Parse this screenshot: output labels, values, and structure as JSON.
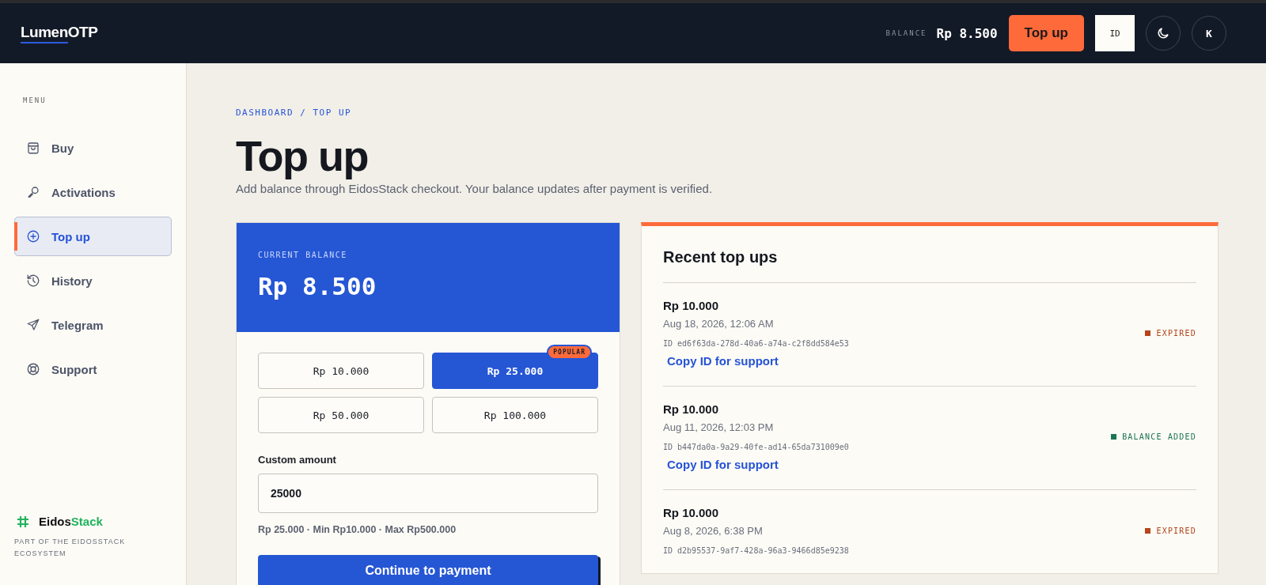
{
  "header": {
    "logo_left": "Lumen",
    "logo_right": "OTP",
    "balance_label": "BALANCE",
    "balance_value": "Rp 8.500",
    "topup_button": "Top up",
    "language_button": "ID",
    "avatar_initial": "K"
  },
  "sidebar": {
    "heading": "MENU",
    "items": [
      {
        "label": "Buy",
        "selected": false
      },
      {
        "label": "Activations",
        "selected": false
      },
      {
        "label": "Top up",
        "selected": true
      },
      {
        "label": "History",
        "selected": false
      },
      {
        "label": "Telegram",
        "selected": false
      },
      {
        "label": "Support",
        "selected": false
      }
    ],
    "footer": {
      "brand_left": "Eidos",
      "brand_right": "Stack",
      "caption": "PART OF THE EIDOSSTACK ECOSYSTEM"
    }
  },
  "breadcrumb": "DASHBOARD / TOP UP",
  "title": "Top up",
  "subtitle": "Add balance through EidosStack checkout. Your balance updates after payment is verified.",
  "balance_card": {
    "label": "CURRENT BALANCE",
    "value": "Rp 8.500"
  },
  "presets": [
    {
      "label": "Rp 10.000",
      "selected": false,
      "kind": "plain"
    },
    {
      "label": "Rp 25.000",
      "selected": true,
      "kind": "popular"
    },
    {
      "label": "Rp 50.000",
      "selected": false,
      "kind": "plain"
    },
    {
      "label": "Rp 100.000",
      "selected": false,
      "kind": "plain"
    }
  ],
  "popular_badge": "POPULAR",
  "custom_amount": {
    "label": "Custom amount",
    "value": "25000",
    "hint": "Rp 25.000 · Min Rp10.000 · Max Rp500.000"
  },
  "continue_button": "Continue to payment",
  "recent": {
    "title": "Recent top ups",
    "items": [
      {
        "amount": "Rp 10.000",
        "date": "Aug 18, 2026, 12:06 AM",
        "id": "ID ed6f63da-278d-40a6-a74a-c2f8dd584e53",
        "status": "EXPIRED",
        "color": "#b5451b",
        "link": "Copy ID for support"
      },
      {
        "amount": "Rp 10.000",
        "date": "Aug 11, 2026, 12:03 PM",
        "id": "ID b447da0a-9a29-40fe-ad14-65da731009e0",
        "status": "BALANCE ADDED",
        "color": "#1d7555",
        "link": "Copy ID for support"
      },
      {
        "amount": "Rp 10.000",
        "date": "Aug 8, 2026, 6:38 PM",
        "id": "ID d2b95537-9af7-428a-96a3-9466d85e9238",
        "status": "EXPIRED",
        "color": "#b5451b"
      }
    ]
  }
}
